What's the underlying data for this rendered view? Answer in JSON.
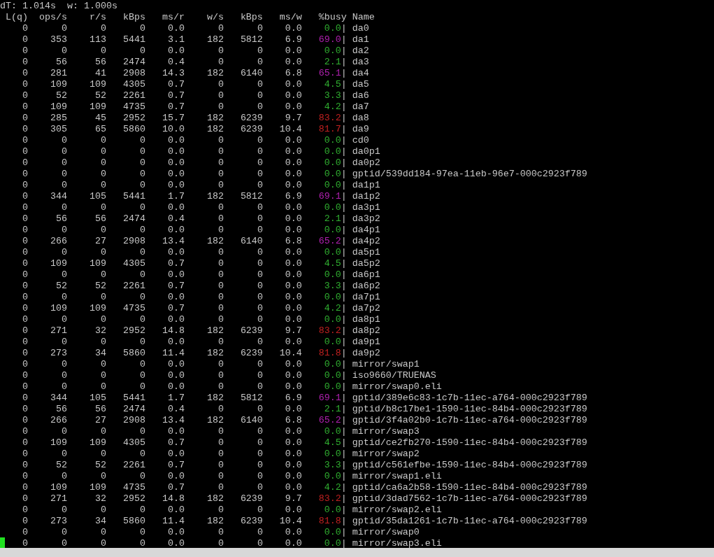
{
  "status_line": {
    "dt": "dT: 1.014s",
    "w": "w: 1.000s"
  },
  "columns": [
    "L(q)",
    "ops/s",
    "r/s",
    "kBps",
    "ms/r",
    "w/s",
    "kBps",
    "ms/w",
    "%busy",
    "Name"
  ],
  "rows": [
    {
      "c": [
        "0",
        "0",
        "0",
        "0",
        "0.0",
        "0",
        "0",
        "0.0"
      ],
      "busy": "0.0",
      "color": "#30b030",
      "sep": "|",
      "name": "da0"
    },
    {
      "c": [
        "0",
        "353",
        "113",
        "5441",
        "3.1",
        "182",
        "5812",
        "6.9"
      ],
      "busy": "69.0",
      "color": "#b020b0",
      "sep": "|",
      "name": "da1"
    },
    {
      "c": [
        "0",
        "0",
        "0",
        "0",
        "0.0",
        "0",
        "0",
        "0.0"
      ],
      "busy": "0.0",
      "color": "#30b030",
      "sep": "|",
      "name": "da2"
    },
    {
      "c": [
        "0",
        "56",
        "56",
        "2474",
        "0.4",
        "0",
        "0",
        "0.0"
      ],
      "busy": "2.1",
      "color": "#30b030",
      "sep": "|",
      "name": "da3"
    },
    {
      "c": [
        "0",
        "281",
        "41",
        "2908",
        "14.3",
        "182",
        "6140",
        "6.8"
      ],
      "busy": "65.1",
      "color": "#b020b0",
      "sep": "|",
      "name": "da4"
    },
    {
      "c": [
        "0",
        "109",
        "109",
        "4305",
        "0.7",
        "0",
        "0",
        "0.0"
      ],
      "busy": "4.5",
      "color": "#30b030",
      "sep": "|",
      "name": "da5"
    },
    {
      "c": [
        "0",
        "52",
        "52",
        "2261",
        "0.7",
        "0",
        "0",
        "0.0"
      ],
      "busy": "3.3",
      "color": "#30b030",
      "sep": "|",
      "name": "da6"
    },
    {
      "c": [
        "0",
        "109",
        "109",
        "4735",
        "0.7",
        "0",
        "0",
        "0.0"
      ],
      "busy": "4.2",
      "color": "#30b030",
      "sep": "|",
      "name": "da7"
    },
    {
      "c": [
        "0",
        "285",
        "45",
        "2952",
        "15.7",
        "182",
        "6239",
        "9.7"
      ],
      "busy": "83.2",
      "color": "#c02020",
      "sep": "|",
      "name": "da8"
    },
    {
      "c": [
        "0",
        "305",
        "65",
        "5860",
        "10.0",
        "182",
        "6239",
        "10.4"
      ],
      "busy": "81.7",
      "color": "#c02020",
      "sep": "|",
      "name": "da9"
    },
    {
      "c": [
        "0",
        "0",
        "0",
        "0",
        "0.0",
        "0",
        "0",
        "0.0"
      ],
      "busy": "0.0",
      "color": "#30b030",
      "sep": "|",
      "name": "cd0"
    },
    {
      "c": [
        "0",
        "0",
        "0",
        "0",
        "0.0",
        "0",
        "0",
        "0.0"
      ],
      "busy": "0.0",
      "color": "#30b030",
      "sep": "|",
      "name": "da0p1"
    },
    {
      "c": [
        "0",
        "0",
        "0",
        "0",
        "0.0",
        "0",
        "0",
        "0.0"
      ],
      "busy": "0.0",
      "color": "#30b030",
      "sep": "|",
      "name": "da0p2"
    },
    {
      "c": [
        "0",
        "0",
        "0",
        "0",
        "0.0",
        "0",
        "0",
        "0.0"
      ],
      "busy": "0.0",
      "color": "#30b030",
      "sep": "|",
      "name": "gptid/539dd184-97ea-11eb-96e7-000c2923f789"
    },
    {
      "c": [
        "0",
        "0",
        "0",
        "0",
        "0.0",
        "0",
        "0",
        "0.0"
      ],
      "busy": "0.0",
      "color": "#30b030",
      "sep": "|",
      "name": "da1p1"
    },
    {
      "c": [
        "0",
        "344",
        "105",
        "5441",
        "1.7",
        "182",
        "5812",
        "6.9"
      ],
      "busy": "69.1",
      "color": "#b020b0",
      "sep": "|",
      "name": "da1p2"
    },
    {
      "c": [
        "0",
        "0",
        "0",
        "0",
        "0.0",
        "0",
        "0",
        "0.0"
      ],
      "busy": "0.0",
      "color": "#30b030",
      "sep": "|",
      "name": "da3p1"
    },
    {
      "c": [
        "0",
        "56",
        "56",
        "2474",
        "0.4",
        "0",
        "0",
        "0.0"
      ],
      "busy": "2.1",
      "color": "#30b030",
      "sep": "|",
      "name": "da3p2"
    },
    {
      "c": [
        "0",
        "0",
        "0",
        "0",
        "0.0",
        "0",
        "0",
        "0.0"
      ],
      "busy": "0.0",
      "color": "#30b030",
      "sep": "|",
      "name": "da4p1"
    },
    {
      "c": [
        "0",
        "266",
        "27",
        "2908",
        "13.4",
        "182",
        "6140",
        "6.8"
      ],
      "busy": "65.2",
      "color": "#b020b0",
      "sep": "|",
      "name": "da4p2"
    },
    {
      "c": [
        "0",
        "0",
        "0",
        "0",
        "0.0",
        "0",
        "0",
        "0.0"
      ],
      "busy": "0.0",
      "color": "#30b030",
      "sep": "|",
      "name": "da5p1"
    },
    {
      "c": [
        "0",
        "109",
        "109",
        "4305",
        "0.7",
        "0",
        "0",
        "0.0"
      ],
      "busy": "4.5",
      "color": "#30b030",
      "sep": "|",
      "name": "da5p2"
    },
    {
      "c": [
        "0",
        "0",
        "0",
        "0",
        "0.0",
        "0",
        "0",
        "0.0"
      ],
      "busy": "0.0",
      "color": "#30b030",
      "sep": "|",
      "name": "da6p1"
    },
    {
      "c": [
        "0",
        "52",
        "52",
        "2261",
        "0.7",
        "0",
        "0",
        "0.0"
      ],
      "busy": "3.3",
      "color": "#30b030",
      "sep": "|",
      "name": "da6p2"
    },
    {
      "c": [
        "0",
        "0",
        "0",
        "0",
        "0.0",
        "0",
        "0",
        "0.0"
      ],
      "busy": "0.0",
      "color": "#30b030",
      "sep": "|",
      "name": "da7p1"
    },
    {
      "c": [
        "0",
        "109",
        "109",
        "4735",
        "0.7",
        "0",
        "0",
        "0.0"
      ],
      "busy": "4.2",
      "color": "#30b030",
      "sep": "|",
      "name": "da7p2"
    },
    {
      "c": [
        "0",
        "0",
        "0",
        "0",
        "0.0",
        "0",
        "0",
        "0.0"
      ],
      "busy": "0.0",
      "color": "#30b030",
      "sep": "|",
      "name": "da8p1"
    },
    {
      "c": [
        "0",
        "271",
        "32",
        "2952",
        "14.8",
        "182",
        "6239",
        "9.7"
      ],
      "busy": "83.2",
      "color": "#c02020",
      "sep": "|",
      "name": "da8p2"
    },
    {
      "c": [
        "0",
        "0",
        "0",
        "0",
        "0.0",
        "0",
        "0",
        "0.0"
      ],
      "busy": "0.0",
      "color": "#30b030",
      "sep": "|",
      "name": "da9p1"
    },
    {
      "c": [
        "0",
        "273",
        "34",
        "5860",
        "11.4",
        "182",
        "6239",
        "10.4"
      ],
      "busy": "81.8",
      "color": "#c02020",
      "sep": "|",
      "name": "da9p2"
    },
    {
      "c": [
        "0",
        "0",
        "0",
        "0",
        "0.0",
        "0",
        "0",
        "0.0"
      ],
      "busy": "0.0",
      "color": "#30b030",
      "sep": "|",
      "name": "mirror/swap1"
    },
    {
      "c": [
        "0",
        "0",
        "0",
        "0",
        "0.0",
        "0",
        "0",
        "0.0"
      ],
      "busy": "0.0",
      "color": "#30b030",
      "sep": "|",
      "name": "iso9660/TRUENAS"
    },
    {
      "c": [
        "0",
        "0",
        "0",
        "0",
        "0.0",
        "0",
        "0",
        "0.0"
      ],
      "busy": "0.0",
      "color": "#30b030",
      "sep": "|",
      "name": "mirror/swap0.eli"
    },
    {
      "c": [
        "0",
        "344",
        "105",
        "5441",
        "1.7",
        "182",
        "5812",
        "6.9"
      ],
      "busy": "69.1",
      "color": "#b020b0",
      "sep": "|",
      "name": "gptid/389e6c83-1c7b-11ec-a764-000c2923f789"
    },
    {
      "c": [
        "0",
        "56",
        "56",
        "2474",
        "0.4",
        "0",
        "0",
        "0.0"
      ],
      "busy": "2.1",
      "color": "#30b030",
      "sep": "|",
      "name": "gptid/b8c17be1-1590-11ec-84b4-000c2923f789"
    },
    {
      "c": [
        "0",
        "266",
        "27",
        "2908",
        "13.4",
        "182",
        "6140",
        "6.8"
      ],
      "busy": "65.2",
      "color": "#b020b0",
      "sep": "|",
      "name": "gptid/3f4a02b0-1c7b-11ec-a764-000c2923f789"
    },
    {
      "c": [
        "0",
        "0",
        "0",
        "0",
        "0.0",
        "0",
        "0",
        "0.0"
      ],
      "busy": "0.0",
      "color": "#30b030",
      "sep": "|",
      "name": "mirror/swap3"
    },
    {
      "c": [
        "0",
        "109",
        "109",
        "4305",
        "0.7",
        "0",
        "0",
        "0.0"
      ],
      "busy": "4.5",
      "color": "#30b030",
      "sep": "|",
      "name": "gptid/ce2fb270-1590-11ec-84b4-000c2923f789"
    },
    {
      "c": [
        "0",
        "0",
        "0",
        "0",
        "0.0",
        "0",
        "0",
        "0.0"
      ],
      "busy": "0.0",
      "color": "#30b030",
      "sep": "|",
      "name": "mirror/swap2"
    },
    {
      "c": [
        "0",
        "52",
        "52",
        "2261",
        "0.7",
        "0",
        "0",
        "0.0"
      ],
      "busy": "3.3",
      "color": "#30b030",
      "sep": "|",
      "name": "gptid/c561efbe-1590-11ec-84b4-000c2923f789"
    },
    {
      "c": [
        "0",
        "0",
        "0",
        "0",
        "0.0",
        "0",
        "0",
        "0.0"
      ],
      "busy": "0.0",
      "color": "#30b030",
      "sep": "|",
      "name": "mirror/swap1.eli"
    },
    {
      "c": [
        "0",
        "109",
        "109",
        "4735",
        "0.7",
        "0",
        "0",
        "0.0"
      ],
      "busy": "4.2",
      "color": "#30b030",
      "sep": "|",
      "name": "gptid/ca6a2b58-1590-11ec-84b4-000c2923f789"
    },
    {
      "c": [
        "0",
        "271",
        "32",
        "2952",
        "14.8",
        "182",
        "6239",
        "9.7"
      ],
      "busy": "83.2",
      "color": "#c02020",
      "sep": "|",
      "name": "gptid/3dad7562-1c7b-11ec-a764-000c2923f789"
    },
    {
      "c": [
        "0",
        "0",
        "0",
        "0",
        "0.0",
        "0",
        "0",
        "0.0"
      ],
      "busy": "0.0",
      "color": "#30b030",
      "sep": "|",
      "name": "mirror/swap2.eli"
    },
    {
      "c": [
        "0",
        "273",
        "34",
        "5860",
        "11.4",
        "182",
        "6239",
        "10.4"
      ],
      "busy": "81.8",
      "color": "#c02020",
      "sep": "|",
      "name": "gptid/35da1261-1c7b-11ec-a764-000c2923f789"
    },
    {
      "c": [
        "0",
        "0",
        "0",
        "0",
        "0.0",
        "0",
        "0",
        "0.0"
      ],
      "busy": "0.0",
      "color": "#30b030",
      "sep": "|",
      "name": "mirror/swap0"
    },
    {
      "c": [
        "0",
        "0",
        "0",
        "0",
        "0.0",
        "0",
        "0",
        "0.0"
      ],
      "busy": "0.0",
      "color": "#30b030",
      "sep": "|",
      "name": "mirror/swap3.eli"
    }
  ]
}
